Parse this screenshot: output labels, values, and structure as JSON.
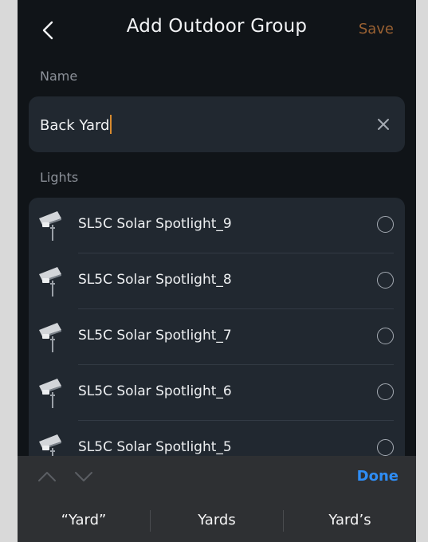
{
  "header": {
    "title": "Add Outdoor Group",
    "save_label": "Save",
    "back_icon": "chevron-left-icon"
  },
  "name_section": {
    "label": "Name",
    "value": "Back Yard",
    "clear_icon": "close-icon"
  },
  "lights_section": {
    "label": "Lights",
    "items": [
      {
        "label": "SL5C Solar Spotlight_9",
        "selected": false
      },
      {
        "label": "SL5C Solar Spotlight_8",
        "selected": false
      },
      {
        "label": "SL5C Solar Spotlight_7",
        "selected": false
      },
      {
        "label": "SL5C Solar Spotlight_6",
        "selected": false
      },
      {
        "label": "SL5C Solar Spotlight_5",
        "selected": false
      }
    ]
  },
  "keyboard": {
    "done_label": "Done",
    "suggestions": [
      "“Yard”",
      "Yards",
      "Yard’s"
    ]
  },
  "colors": {
    "background": "#101418",
    "card": "#212830",
    "accent_save": "#9a6132",
    "caret": "#d88a2e",
    "done": "#2f8df5"
  }
}
